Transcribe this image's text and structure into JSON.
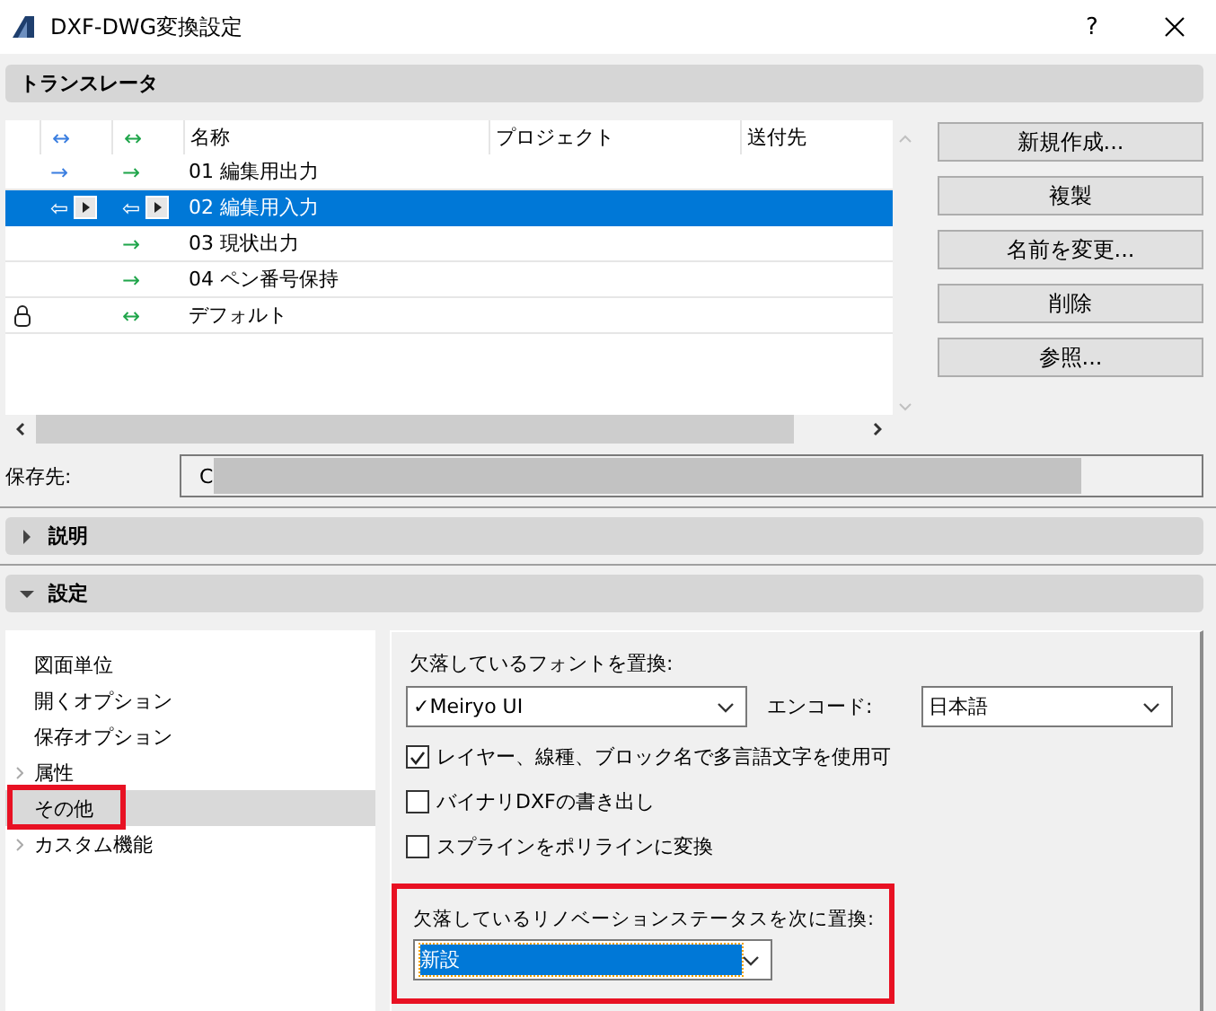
{
  "window": {
    "title": "DXF-DWG変換設定",
    "help": "?"
  },
  "translator": {
    "header": "トランスレータ",
    "columns": [
      "名称",
      "プロジェクト",
      "送付先"
    ],
    "column_icons": [
      "↔",
      "↔"
    ],
    "rows": [
      {
        "name": "01 編集用出力",
        "lock": false,
        "dxf": "→",
        "dwg": "→",
        "selected": false
      },
      {
        "name": "02 編集用入力",
        "lock": false,
        "dxf": "⇦",
        "dwg": "⇦",
        "selected": true
      },
      {
        "name": "03 現状出力",
        "lock": false,
        "dwg": "→",
        "selected": false
      },
      {
        "name": "04 ペン番号保持",
        "lock": false,
        "dwg": "→",
        "selected": false
      },
      {
        "name": "デフォルト",
        "lock": true,
        "dwg": "↔",
        "selected": false
      }
    ],
    "buttons": [
      "新規作成...",
      "複製",
      "名前を変更...",
      "削除",
      "参照..."
    ]
  },
  "save_to": {
    "label": "保存先:",
    "value": "C"
  },
  "sections": [
    {
      "title": "説明",
      "expanded": false
    },
    {
      "title": "設定",
      "expanded": true
    }
  ],
  "settings_list": [
    {
      "label": "図面単位",
      "has_children": false,
      "selected": false,
      "highlighted": false
    },
    {
      "label": "開くオプション",
      "has_children": false,
      "selected": false,
      "highlighted": false
    },
    {
      "label": "保存オプション",
      "has_children": false,
      "selected": false,
      "highlighted": false
    },
    {
      "label": "属性",
      "has_children": true,
      "selected": false,
      "highlighted": false
    },
    {
      "label": "その他",
      "has_children": false,
      "selected": true,
      "highlighted": true
    },
    {
      "label": "カスタム機能",
      "has_children": true,
      "selected": false,
      "highlighted": false
    }
  ],
  "font_replace": {
    "label": "欠落しているフォントを置換:",
    "value": "✓Meiryo UI",
    "encode_label": "エンコード:",
    "encode_value": "日本語"
  },
  "options": [
    {
      "label": "レイヤー、線種、ブロック名で多言語文字を使用可",
      "checked": true
    },
    {
      "label": "バイナリDXFの書き出し",
      "checked": false
    },
    {
      "label": "スプラインをポリラインに変換",
      "checked": false
    }
  ],
  "revision": {
    "label": "欠落しているリノベーションステータスを次に置換:",
    "value": "新設",
    "highlighted": true
  }
}
